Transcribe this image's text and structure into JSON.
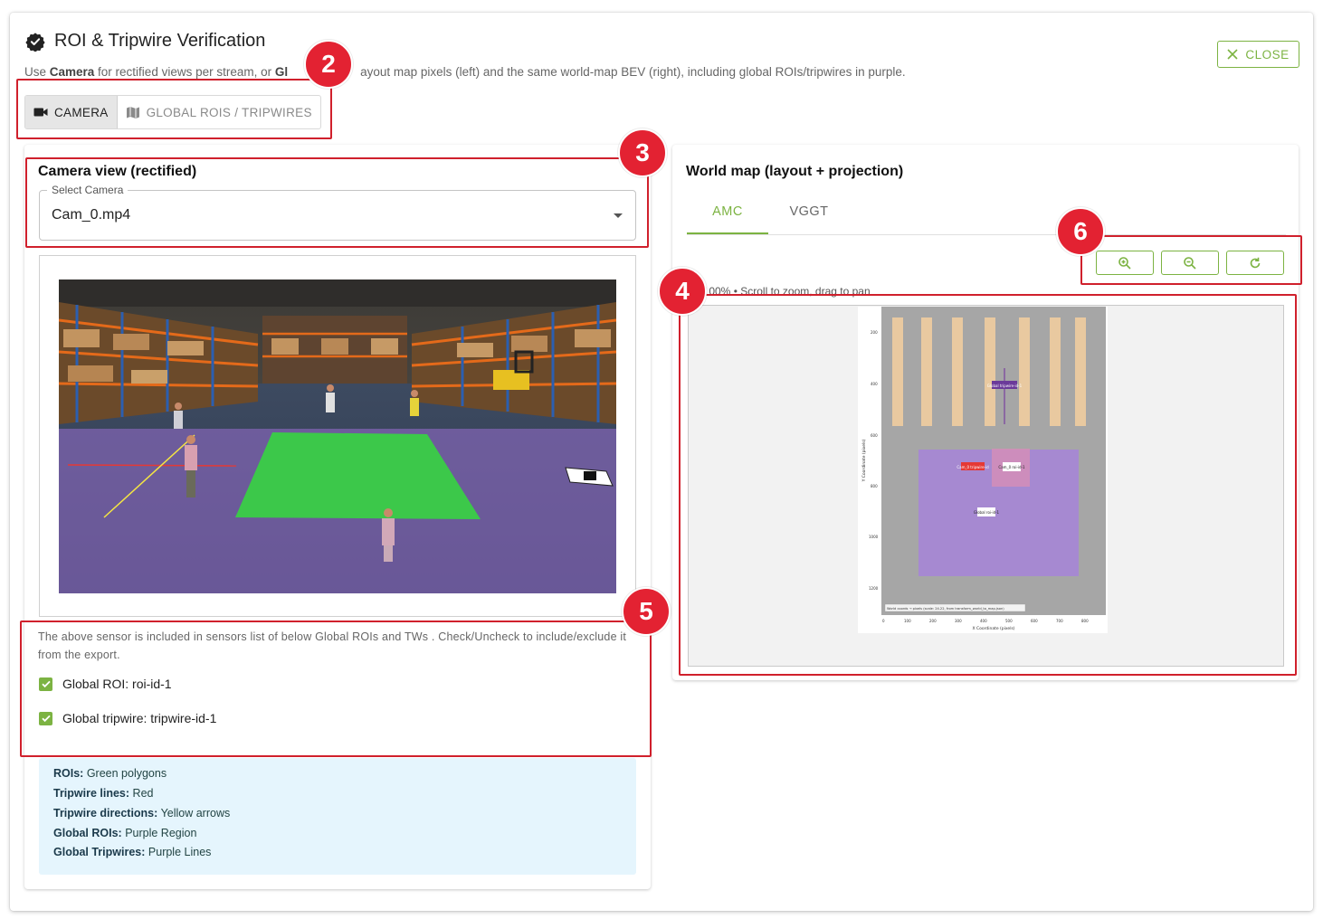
{
  "dialog": {
    "title": "ROI & Tripwire Verification",
    "subtitle_prefix": "Use ",
    "subtitle_bold1": "Camera",
    "subtitle_mid": " for rectified views per stream, or ",
    "subtitle_bold2": "Gl",
    "subtitle_rest": "ayout map pixels (left) and the same world-map BEV (right), including global ROIs/tripwires in purple.",
    "close_label": "CLOSE"
  },
  "view_toggle": {
    "camera_label": "CAMERA",
    "global_label": "GLOBAL ROIS / TRIPWIRES",
    "selected": "CAMERA"
  },
  "camera_panel": {
    "title": "Camera view (rectified)",
    "select_label": "Select Camera",
    "select_value": "Cam_0.mp4",
    "sensor_note": "The above sensor is included in sensors list of below Global ROIs and TWs . Check/Uncheck to include/exclude it from the export.",
    "checks": [
      {
        "label": "Global ROI: roi-id-1",
        "checked": true
      },
      {
        "label": "Global tripwire: tripwire-id-1",
        "checked": true
      }
    ],
    "legend": [
      {
        "key": "ROIs:",
        "value": "Green polygons"
      },
      {
        "key": "Tripwire lines:",
        "value": "Red"
      },
      {
        "key": "Tripwire directions:",
        "value": "Yellow arrows"
      },
      {
        "key": "Global ROIs:",
        "value": "Purple Region"
      },
      {
        "key": "Global Tripwires:",
        "value": "Purple Lines"
      }
    ]
  },
  "map_panel": {
    "title": "World map (layout + projection)",
    "tabs": [
      "AMC",
      "VGGT"
    ],
    "active_tab": "AMC",
    "zoom_text": "m: 100% • Scroll to zoom, drag to pan",
    "map": {
      "y_axis_label": "Y Coordinate (pixels)",
      "x_axis_label": "X Coordinate (pixels)",
      "y_ticks": [
        "200",
        "400",
        "600",
        "800",
        "1000",
        "1200"
      ],
      "x_ticks": [
        "0",
        "100",
        "200",
        "300",
        "400",
        "500",
        "600",
        "700",
        "800"
      ],
      "footer_note": "World coords → pixels (scale: 24.22, from transform_world_to_map.json)",
      "labels": {
        "global_tripwire": "Global tripwire-id-1",
        "tripwire_red": "Cam_0 tripwire-id",
        "cam_roi": "Cam_0 roi-id-1",
        "global_roi": "Global roi-id-1"
      }
    }
  },
  "annotations": [
    "2",
    "3",
    "4",
    "5",
    "6"
  ],
  "colors": {
    "accent": "#7cb342",
    "annotation": "#e32232",
    "roi": "#3cc84a",
    "tripwire": "#e53935",
    "direction": "#f5e642",
    "global": "#9b7fc9",
    "legend_bg": "#e5f5fd"
  }
}
